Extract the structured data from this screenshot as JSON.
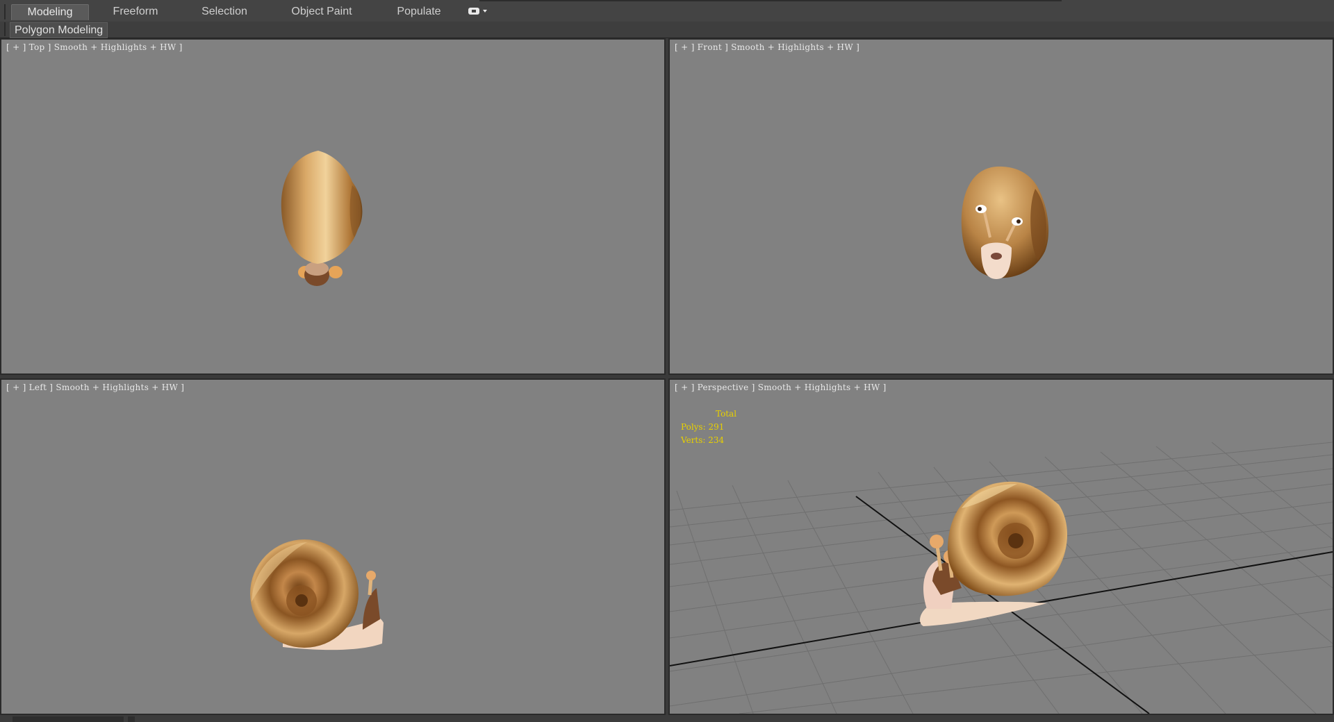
{
  "ribbon": {
    "tabs": [
      {
        "label": "Modeling",
        "active": true
      },
      {
        "label": "Freeform",
        "active": false
      },
      {
        "label": "Selection",
        "active": false
      },
      {
        "label": "Object Paint",
        "active": false
      },
      {
        "label": "Populate",
        "active": false
      }
    ],
    "panel_label": "Polygon Modeling",
    "toggle_icon": "ribbon-minimize-icon"
  },
  "viewports": {
    "top": {
      "label": "[ + ] Top ] Smooth + Highlights + HW ]"
    },
    "front": {
      "label": "[ + ] Front ] Smooth + Highlights + HW ]"
    },
    "left": {
      "label": "[ + ] Left ] Smooth + Highlights + HW ]"
    },
    "perspective": {
      "label": "[ + ] Perspective ] Smooth + Highlights + HW ]",
      "stats": {
        "heading": "Total",
        "polys": "Polys: 291",
        "verts": "Verts: 234"
      }
    }
  },
  "colors": {
    "viewport_bg": "#818181",
    "stats_text": "#e8d000",
    "shell": "#c79a5c",
    "body": "#f2d9c4"
  }
}
